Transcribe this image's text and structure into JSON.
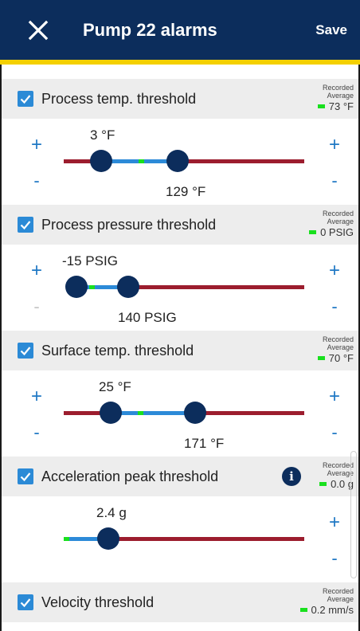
{
  "header": {
    "title": "Pump 22 alarms",
    "save_label": "Save",
    "colors": {
      "bar": "#0c2d5c",
      "accent": "#f4d000"
    }
  },
  "recorded_label_1": "Recorded",
  "recorded_label_2": "Average",
  "controls": {
    "plus": "+",
    "minus": "-"
  },
  "sections": [
    {
      "label": "Process temp. threshold",
      "checked": true,
      "recorded_average": "73 °F",
      "low_value": "3 °F",
      "high_value": "129 °F"
    },
    {
      "label": "Process pressure threshold",
      "checked": true,
      "recorded_average": "0 PSIG",
      "low_value": "-15 PSIG",
      "high_value": "140 PSIG",
      "minus_disabled": true
    },
    {
      "label": "Surface temp. threshold",
      "checked": true,
      "recorded_average": "70 °F",
      "low_value": "25 °F",
      "high_value": "171 °F"
    },
    {
      "label": "Acceleration peak threshold",
      "checked": true,
      "recorded_average": "0.0 g",
      "single_value": "2.4 g",
      "info_icon": "i"
    },
    {
      "label": "Velocity threshold",
      "checked": true,
      "recorded_average": "0.2 mm/s"
    }
  ]
}
